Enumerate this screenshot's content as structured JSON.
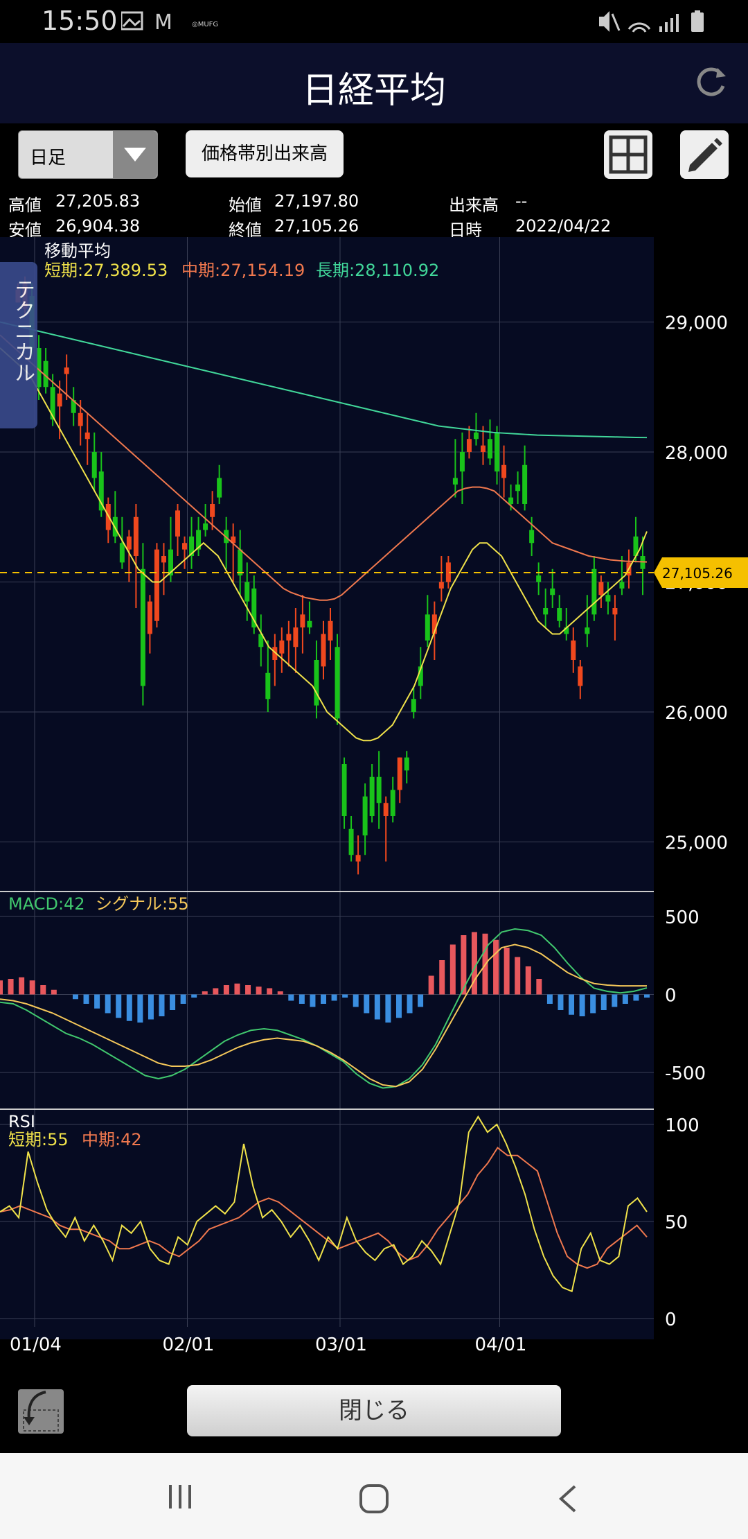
{
  "status": {
    "time": "15:50"
  },
  "title": "日経平均",
  "toolbar": {
    "period": "日足",
    "volume_button": "価格帯別出来高"
  },
  "price_info": {
    "high_label": "高値",
    "high": "27,205.83",
    "low_label": "安値",
    "low": "26,904.38",
    "open_label": "始値",
    "open": "27,197.80",
    "close_label": "終値",
    "close": "27,105.26",
    "volume_label": "出来高",
    "volume": "--",
    "date_label": "日時",
    "date": "2022/04/22"
  },
  "technical_tab": "テクニカル",
  "ma": {
    "label": "移動平均",
    "short": "短期:27,389.53",
    "mid": "中期:27,154.19",
    "long": "長期:28,110.92"
  },
  "macd_legend": {
    "macd": "MACD:42",
    "signal": "シグナル:55"
  },
  "rsi_legend": {
    "label": "RSI",
    "short": "短期:55",
    "mid": "中期:42"
  },
  "price_axis": [
    "29,000",
    "28,000",
    "27,000",
    "26,000",
    "25,000"
  ],
  "current_price_tag": "27,105.26",
  "macd_axis": [
    "500",
    "0",
    "-500"
  ],
  "rsi_axis": [
    "100",
    "50",
    "0"
  ],
  "date_axis": [
    "01/04",
    "02/01",
    "03/01",
    "04/01"
  ],
  "close_button": "閉じる",
  "colors": {
    "bg": "#060b22",
    "up": "#f0481e",
    "down": "#19c31a",
    "ma_short": "#f0e24a",
    "ma_mid": "#f0784e",
    "ma_long": "#41d79a",
    "macd": "#41c86e",
    "signal": "#f5c85a",
    "hist_pos": "#e8585d",
    "hist_neg": "#3a8ee0"
  },
  "chart_data": {
    "type": "candlestick",
    "price_ylim": [
      24800,
      29600
    ],
    "macd_ylim": [
      -700,
      500
    ],
    "rsi_ylim": [
      0,
      100
    ],
    "candles": [
      [
        29150,
        29300,
        29200,
        29250
      ],
      [
        29100,
        29350,
        29050,
        29300
      ],
      [
        29200,
        29300,
        28750,
        28800
      ],
      [
        28800,
        28900,
        28400,
        28500
      ],
      [
        28700,
        28800,
        28450,
        28500
      ],
      [
        28500,
        28600,
        28200,
        28250
      ],
      [
        28350,
        28550,
        28100,
        28450
      ],
      [
        28600,
        28750,
        28400,
        28650
      ],
      [
        28400,
        28500,
        28200,
        28300
      ],
      [
        28200,
        28400,
        28050,
        28300
      ],
      [
        28100,
        28300,
        27900,
        28150
      ],
      [
        28000,
        28150,
        27700,
        27800
      ],
      [
        27850,
        28000,
        27500,
        27550
      ],
      [
        27400,
        27650,
        27300,
        27600
      ],
      [
        27500,
        27700,
        27300,
        27350
      ],
      [
        27300,
        27500,
        27100,
        27150
      ],
      [
        27250,
        27400,
        27000,
        27350
      ],
      [
        27200,
        27600,
        26800,
        27500
      ],
      [
        27100,
        27300,
        26050,
        26200
      ],
      [
        26600,
        26900,
        26450,
        26850
      ],
      [
        26700,
        27300,
        26650,
        27250
      ],
      [
        27150,
        27300,
        26900,
        27200
      ],
      [
        27250,
        27500,
        27000,
        27050
      ],
      [
        27350,
        27600,
        27200,
        27550
      ],
      [
        27250,
        27350,
        27100,
        27300
      ],
      [
        27350,
        27500,
        27100,
        27200
      ],
      [
        27400,
        27500,
        27200,
        27250
      ],
      [
        27450,
        27600,
        27350,
        27400
      ],
      [
        27500,
        27700,
        27400,
        27600
      ],
      [
        27800,
        27900,
        27600,
        27650
      ],
      [
        27400,
        27500,
        27100,
        27300
      ],
      [
        27300,
        27450,
        27000,
        27350
      ],
      [
        27250,
        27400,
        26900,
        27050
      ],
      [
        27000,
        27150,
        26700,
        26850
      ],
      [
        26950,
        27050,
        26600,
        26650
      ],
      [
        26600,
        26750,
        26350,
        26500
      ],
      [
        26300,
        26550,
        26000,
        26100
      ],
      [
        26400,
        26600,
        26200,
        26500
      ],
      [
        26450,
        26650,
        26300,
        26550
      ],
      [
        26550,
        26700,
        26350,
        26600
      ],
      [
        26500,
        26800,
        26300,
        26650
      ],
      [
        26650,
        26900,
        26450,
        26750
      ],
      [
        26700,
        26850,
        26600,
        26650
      ],
      [
        26400,
        26550,
        25950,
        26050
      ],
      [
        26350,
        26700,
        26250,
        26600
      ],
      [
        26550,
        26800,
        26400,
        26700
      ],
      [
        26500,
        26600,
        25900,
        25950
      ],
      [
        25600,
        25650,
        25100,
        25200
      ],
      [
        25100,
        25200,
        24850,
        24900
      ],
      [
        24850,
        25050,
        24750,
        24900
      ],
      [
        25350,
        25450,
        24900,
        25050
      ],
      [
        25500,
        25600,
        25150,
        25200
      ],
      [
        25500,
        25700,
        25100,
        25300
      ],
      [
        25200,
        25350,
        24850,
        25300
      ],
      [
        25400,
        25500,
        25150,
        25200
      ],
      [
        25400,
        25650,
        25300,
        25650
      ],
      [
        25650,
        25700,
        25450,
        25550
      ],
      [
        26100,
        26200,
        25950,
        26000
      ],
      [
        26350,
        26500,
        26100,
        26200
      ],
      [
        26750,
        26900,
        26500,
        26550
      ],
      [
        26600,
        26850,
        26400,
        26750
      ],
      [
        26950,
        27200,
        26850,
        27000
      ],
      [
        27000,
        27200,
        26950,
        27150
      ],
      [
        27800,
        28100,
        27650,
        27750
      ],
      [
        28000,
        28150,
        27600,
        27850
      ],
      [
        28000,
        28200,
        27950,
        28100
      ],
      [
        28150,
        28300,
        28050,
        28100
      ],
      [
        28000,
        28200,
        27900,
        28050
      ],
      [
        28100,
        28250,
        27900,
        27950
      ],
      [
        28150,
        28200,
        27750,
        27850
      ],
      [
        27800,
        28050,
        27650,
        27900
      ],
      [
        27650,
        27750,
        27550,
        27600
      ],
      [
        27750,
        27850,
        27600,
        27700
      ],
      [
        27900,
        28050,
        27550,
        27600
      ],
      [
        27400,
        27500,
        27200,
        27300
      ],
      [
        27050,
        27150,
        26900,
        27000
      ],
      [
        26800,
        26950,
        26650,
        26750
      ],
      [
        26950,
        27100,
        26800,
        26900
      ],
      [
        26800,
        26900,
        26650,
        26700
      ],
      [
        26650,
        26800,
        26550,
        26600
      ],
      [
        26400,
        26650,
        26300,
        26550
      ],
      [
        26200,
        26400,
        26100,
        26350
      ],
      [
        26650,
        26900,
        26500,
        26600
      ],
      [
        27100,
        27200,
        26700,
        26750
      ],
      [
        26900,
        27050,
        26800,
        27000
      ],
      [
        26900,
        27000,
        26750,
        26850
      ],
      [
        26750,
        26900,
        26550,
        26800
      ],
      [
        27000,
        27200,
        26900,
        26950
      ],
      [
        27050,
        27250,
        26950,
        27150
      ],
      [
        27350,
        27500,
        27150,
        27200
      ],
      [
        27200,
        27350,
        26900,
        27100
      ]
    ],
    "ma_short": [
      28800,
      28750,
      28700,
      28650,
      28600,
      28500,
      28400,
      28300,
      28200,
      28100,
      28000,
      27900,
      27800,
      27700,
      27600,
      27500,
      27400,
      27300,
      27200,
      27100,
      27050,
      27000,
      27000,
      27050,
      27100,
      27150,
      27200,
      27250,
      27300,
      27250,
      27200,
      27100,
      27000,
      26900,
      26800,
      26700,
      26600,
      26500,
      26450,
      26400,
      26350,
      26300,
      26250,
      26200,
      26100,
      26000,
      25950,
      25900,
      25850,
      25800,
      25780,
      25780,
      25800,
      25850,
      25900,
      26000,
      26100,
      26200,
      26350,
      26500,
      26650,
      26800,
      26950,
      27050,
      27150,
      27250,
      27300,
      27300,
      27250,
      27200,
      27100,
      27000,
      26900,
      26800,
      26700,
      26650,
      26600,
      26600,
      26650,
      26700,
      26750,
      26800,
      26850,
      26900,
      26950,
      27000,
      27050,
      27150,
      27250,
      27389
    ],
    "ma_mid": [
      28900,
      28850,
      28800,
      28750,
      28700,
      28650,
      28600,
      28550,
      28500,
      28450,
      28400,
      28350,
      28300,
      28250,
      28200,
      28150,
      28100,
      28050,
      28000,
      27950,
      27900,
      27850,
      27800,
      27750,
      27700,
      27650,
      27600,
      27550,
      27500,
      27450,
      27400,
      27350,
      27300,
      27250,
      27200,
      27150,
      27100,
      27050,
      27000,
      26950,
      26920,
      26900,
      26880,
      26870,
      26860,
      26860,
      26870,
      26900,
      26950,
      27000,
      27050,
      27100,
      27150,
      27200,
      27250,
      27300,
      27350,
      27400,
      27450,
      27500,
      27550,
      27600,
      27650,
      27700,
      27720,
      27730,
      27730,
      27720,
      27700,
      27650,
      27600,
      27550,
      27500,
      27450,
      27400,
      27350,
      27300,
      27280,
      27260,
      27240,
      27220,
      27200,
      27190,
      27180,
      27170,
      27165,
      27160,
      27158,
      27156,
      27154
    ],
    "ma_long": [
      29000,
      28980,
      28960,
      28940,
      28920,
      28900,
      28880,
      28860,
      28840,
      28820,
      28800,
      28780,
      28760,
      28740,
      28720,
      28700,
      28680,
      28660,
      28640,
      28620,
      28600,
      28580,
      28560,
      28540,
      28520,
      28500,
      28480,
      28460,
      28440,
      28420,
      28400,
      28380,
      28360,
      28340,
      28320,
      28300,
      28280,
      28260,
      28240,
      28220,
      28200,
      28190,
      28180,
      28170,
      28160,
      28150,
      28145,
      28140,
      28135,
      28130,
      28128,
      28126,
      28124,
      28122,
      28120,
      28118,
      28116,
      28114,
      28112,
      28111
    ],
    "macd": [
      -50,
      -60,
      -100,
      -150,
      -200,
      -250,
      -280,
      -320,
      -370,
      -420,
      -470,
      -520,
      -540,
      -520,
      -480,
      -420,
      -360,
      -300,
      -260,
      -230,
      -220,
      -230,
      -260,
      -290,
      -330,
      -380,
      -430,
      -510,
      -570,
      -600,
      -590,
      -540,
      -450,
      -320,
      -150,
      20,
      180,
      320,
      400,
      420,
      410,
      380,
      300,
      200,
      110,
      40,
      20,
      10,
      20,
      42
    ],
    "signal": [
      -30,
      -40,
      -60,
      -90,
      -120,
      -160,
      -200,
      -240,
      -280,
      -320,
      -360,
      -400,
      -440,
      -460,
      -460,
      -450,
      -420,
      -380,
      -340,
      -310,
      -290,
      -280,
      -290,
      -300,
      -330,
      -370,
      -420,
      -480,
      -540,
      -580,
      -590,
      -560,
      -480,
      -350,
      -200,
      -50,
      100,
      220,
      300,
      320,
      300,
      260,
      200,
      140,
      100,
      70,
      60,
      55,
      55,
      55
    ],
    "macd_hist": [
      90,
      100,
      110,
      90,
      60,
      30,
      0,
      -30,
      -60,
      -90,
      -120,
      -150,
      -170,
      -180,
      -160,
      -140,
      -100,
      -60,
      -20,
      20,
      40,
      60,
      70,
      60,
      50,
      40,
      20,
      -40,
      -60,
      -80,
      -60,
      -40,
      -20,
      -80,
      -120,
      -160,
      -180,
      -150,
      -120,
      -80,
      120,
      220,
      320,
      380,
      400,
      390,
      350,
      300,
      240,
      180,
      100,
      -60,
      -100,
      -130,
      -140,
      -120,
      -100,
      -80,
      -60,
      -40,
      -20
    ],
    "rsi_short": [
      55,
      58,
      52,
      86,
      70,
      56,
      48,
      42,
      52,
      40,
      48,
      40,
      30,
      48,
      44,
      50,
      36,
      30,
      28,
      42,
      38,
      50,
      54,
      58,
      54,
      60,
      90,
      68,
      52,
      56,
      50,
      42,
      48,
      40,
      30,
      42,
      36,
      52,
      40,
      34,
      30,
      36,
      38,
      28,
      32,
      40,
      35,
      28,
      44,
      60,
      96,
      104,
      96,
      100,
      90,
      78,
      64,
      46,
      32,
      22,
      16,
      14,
      36,
      44,
      30,
      28,
      32,
      58,
      62,
      55
    ],
    "rsi_mid": [
      55,
      56,
      58,
      56,
      54,
      52,
      48,
      46,
      46,
      44,
      42,
      40,
      36,
      36,
      38,
      40,
      38,
      34,
      32,
      36,
      40,
      46,
      48,
      50,
      52,
      56,
      60,
      62,
      60,
      56,
      52,
      48,
      44,
      40,
      36,
      38,
      40,
      42,
      44,
      40,
      34,
      30,
      32,
      38,
      46,
      52,
      58,
      64,
      74,
      80,
      88,
      84,
      84,
      80,
      76,
      60,
      44,
      32,
      28,
      26,
      28,
      36,
      40,
      44,
      48,
      42
    ],
    "dates": [
      "01/04",
      "02/01",
      "03/01",
      "04/01"
    ]
  }
}
